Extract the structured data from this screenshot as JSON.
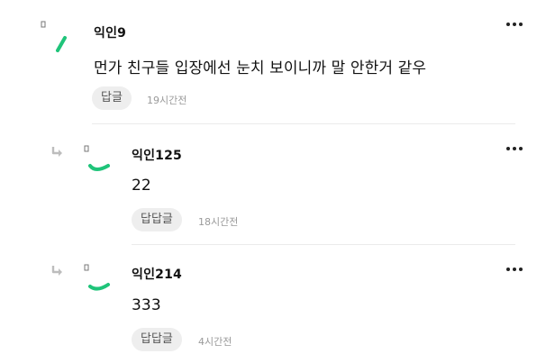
{
  "comments": [
    {
      "username": "익인9",
      "text": "먼가 친구들 입장에선 눈치 보이니까 말 안한거 같우",
      "reply_label": "답글",
      "time": "19시간전"
    },
    {
      "username": "익인125",
      "text": "22",
      "reply_label": "답답글",
      "time": "18시간전"
    },
    {
      "username": "익인214",
      "text": "333",
      "reply_label": "답답글",
      "time": "4시간전"
    }
  ],
  "more_menu_icon": "more-horizontal-icon",
  "reply_arrow_icon": "reply-arrow-icon",
  "colors": {
    "accent_green": "#1fc47a",
    "pill_bg": "#eeeeee",
    "muted_text": "#9a9a9a",
    "divider": "#ebebeb"
  }
}
